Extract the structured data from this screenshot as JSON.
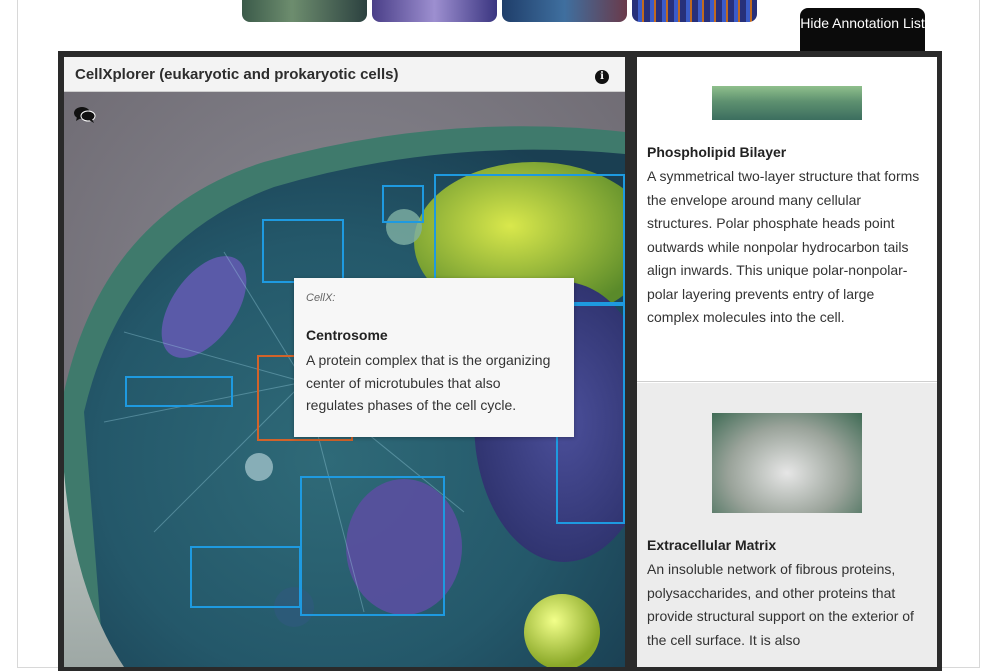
{
  "thumbnails": [
    "cell-scene-1",
    "cell-scene-2",
    "cell-scene-3",
    "cell-scene-4"
  ],
  "hide_button": {
    "label": "Hide Annotation List"
  },
  "viewer": {
    "title": "CellXplorer (eukaryotic and prokaryotic cells)",
    "info_icon": "info-icon",
    "chat_icon": "chat-bubbles-icon"
  },
  "tooltip": {
    "source": "CellX:",
    "title": "Centrosome",
    "text": "A protein complex that is the organizing center of microtubules that also regulates phases of the cell cycle."
  },
  "annotations": [
    {
      "title": "Phospholipid Bilayer",
      "text": "A symmetrical two-layer structure that forms the envelope around many cellular structures. Polar phosphate heads point outwards while nonpolar hydrocarbon tails align inwards. This unique polar-nonpolar-polar layering prevents entry of large complex molecules into the cell."
    },
    {
      "title": "Extracellular Matrix",
      "text": "An insoluble network of fibrous proteins, polysaccharides, and other proteins that provide structural support on the exterior of the cell surface. It is also"
    }
  ],
  "colors": {
    "hotspot": "#1e9ae0",
    "hotspot_selected": "#d2632a",
    "panel_bg": "#2a2a2a"
  }
}
